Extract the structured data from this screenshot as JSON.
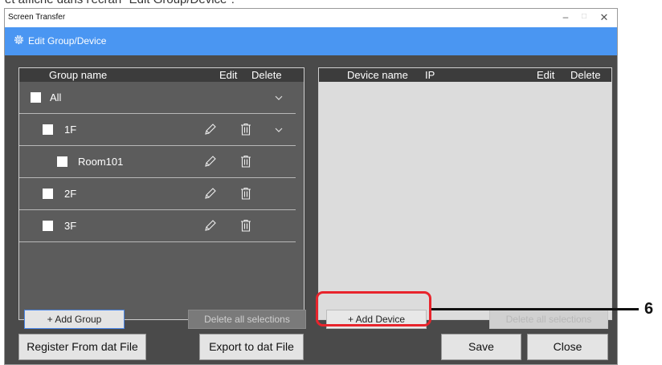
{
  "doc": {
    "caption_fragment": "et affiche dans l'écran \"Edit Group/Device\"."
  },
  "window": {
    "title": "Screen Transfer",
    "minimize": "–",
    "maximize": "□",
    "close": "✕"
  },
  "header": {
    "title": "Edit Group/Device",
    "icon": "gear-icon"
  },
  "groups": {
    "columns": {
      "name": "Group name",
      "edit": "Edit",
      "delete": "Delete"
    },
    "rows": [
      {
        "label": "All",
        "checked": false,
        "editable": false,
        "expandable": true
      },
      {
        "label": "1F",
        "checked": false,
        "editable": true,
        "expandable": true
      },
      {
        "label": "Room101",
        "checked": false,
        "editable": true,
        "expandable": false
      },
      {
        "label": "2F",
        "checked": false,
        "editable": true,
        "expandable": false
      },
      {
        "label": "3F",
        "checked": false,
        "editable": true,
        "expandable": false
      }
    ],
    "add_button": "+ Add Group",
    "delete_all": "Delete all selections"
  },
  "devices": {
    "columns": {
      "name": "Device name",
      "ip": "IP",
      "edit": "Edit",
      "delete": "Delete"
    },
    "rows": [],
    "add_button": "+ Add Device",
    "delete_all": "Delete all selections"
  },
  "bottom": {
    "register": "Register From dat File",
    "export": "Export to dat File",
    "save": "Save",
    "close": "Close"
  },
  "annotation": {
    "number": "6",
    "color": "#e8242c"
  },
  "colors": {
    "header": "#4a96f2",
    "window_bg": "#4a4a4a",
    "left_panel": "#5c5c5c",
    "right_panel": "#dcdcdc"
  }
}
